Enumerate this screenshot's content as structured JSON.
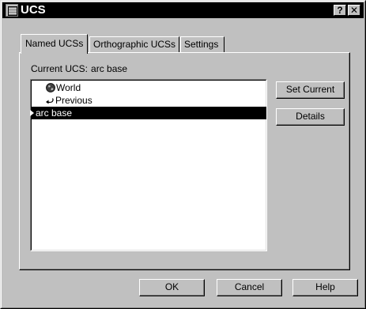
{
  "window": {
    "title": "UCS",
    "help_glyph": "?",
    "close_glyph": "✕"
  },
  "tabs": [
    {
      "label": "Named UCSs",
      "active": true
    },
    {
      "label": "Orthographic UCSs",
      "active": false
    },
    {
      "label": "Settings",
      "active": false
    }
  ],
  "current": {
    "label": "Current UCS:",
    "value": "arc base"
  },
  "list": {
    "items": [
      {
        "label": "World",
        "icon": "globe-icon"
      },
      {
        "label": "Previous",
        "icon": "return-arrow-icon"
      },
      {
        "label": "arc base",
        "icon": "selection-marker",
        "selected": true
      }
    ]
  },
  "side_buttons": {
    "set_current": "Set Current",
    "details": "Details"
  },
  "footer_buttons": {
    "ok": "OK",
    "cancel": "Cancel",
    "help": "Help"
  }
}
